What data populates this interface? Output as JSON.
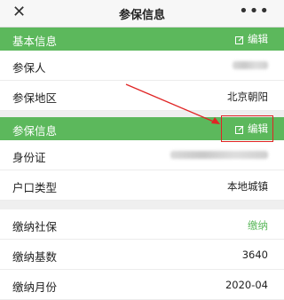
{
  "topbar": {
    "close_glyph": "✕",
    "title": "参保信息",
    "more_glyph": "•••"
  },
  "basic": {
    "header": "基本信息",
    "edit": "编辑",
    "rows": [
      {
        "label": "参保人",
        "value": ""
      },
      {
        "label": "参保地区",
        "value": "北京朝阳"
      }
    ]
  },
  "insured": {
    "header": "参保信息",
    "edit": "编辑",
    "rows": [
      {
        "label": "身份证",
        "value": ""
      },
      {
        "label": "户口类型",
        "value": "本地城镇"
      }
    ]
  },
  "payment": {
    "rows": [
      {
        "label": "缴纳社保",
        "value": "缴纳"
      },
      {
        "label": "缴纳基数",
        "value": "3640"
      },
      {
        "label": "缴纳月份",
        "value": "2020-04"
      }
    ]
  },
  "colors": {
    "accent": "#5cb85c",
    "annotation": "#e02424"
  },
  "icons": [
    "close-icon",
    "more-icon",
    "edit-icon"
  ]
}
